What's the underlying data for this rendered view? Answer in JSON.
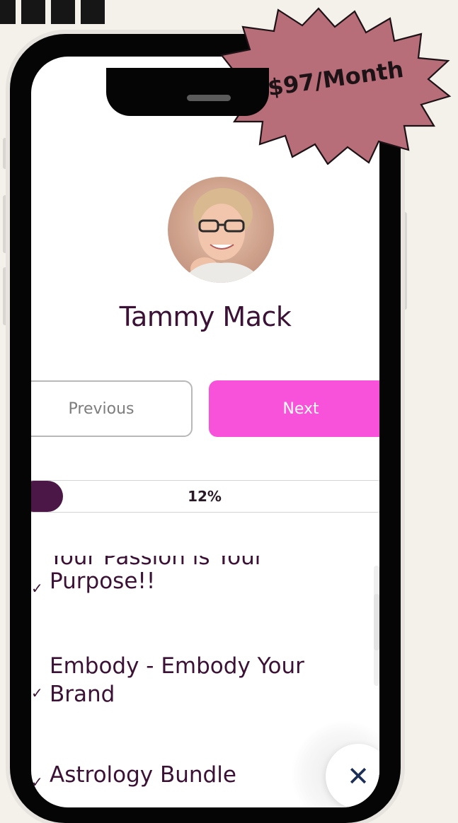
{
  "profile": {
    "name": "Tammy Mack"
  },
  "navigation": {
    "previous_label": "Previous",
    "next_label": "Next"
  },
  "progress": {
    "percent": 12,
    "label": "12%"
  },
  "courses": {
    "items": [
      {
        "line1": "Your Passion is Your",
        "line2": "Purpose!!"
      },
      {
        "line1": "Embody - Embody Your",
        "line2": "Brand"
      },
      {
        "line1": "Astrology Bundle",
        "line2": ""
      }
    ]
  },
  "price_badge": {
    "label": "$97/Month"
  },
  "colors": {
    "page_bg": "#f4f0ea",
    "accent_pink": "#f752d9",
    "primary_text": "#3b1235",
    "progress_fill": "#4b1746",
    "badge_fill": "#b86e78",
    "close_icon": "#1c2f57"
  },
  "icons": {
    "close": "close-icon",
    "check": "check-icon"
  }
}
